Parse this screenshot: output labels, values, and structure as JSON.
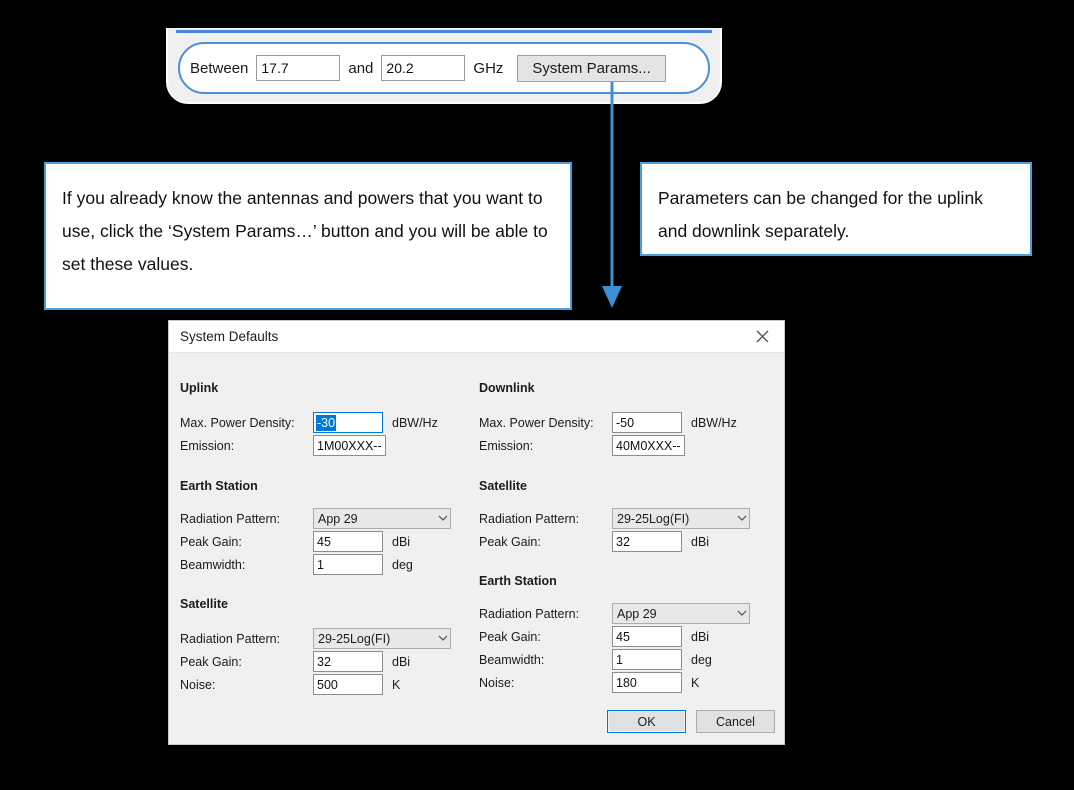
{
  "toolbar": {
    "between_label": "Between",
    "freq_low": "17.7",
    "and_label": "and",
    "freq_high": "20.2",
    "unit_label": "GHz",
    "system_params_button": "System Params..."
  },
  "annotations": {
    "left": "If you already know the antennas and powers that you want to use, click the ‘System Params…’ button and you will be able to set these values.",
    "right": "Parameters can be changed for the uplink and downlink separately."
  },
  "dialog": {
    "title": "System Defaults",
    "close_icon": "close-icon",
    "uplink": {
      "heading": "Uplink",
      "rows": [
        {
          "label": "Max. Power Density:",
          "value": "-30",
          "unit": "dBW/Hz",
          "type": "text",
          "focused": true,
          "selected": true
        },
        {
          "label": "Emission:",
          "value": "1M00XXX--",
          "unit": "",
          "type": "text-wide"
        }
      ],
      "earth_station": {
        "heading": "Earth Station",
        "rows": [
          {
            "label": "Radiation Pattern:",
            "value": "App 29",
            "unit": "",
            "type": "combo"
          },
          {
            "label": "Peak Gain:",
            "value": "45",
            "unit": "dBi",
            "type": "text"
          },
          {
            "label": "Beamwidth:",
            "value": "1",
            "unit": "deg",
            "type": "text"
          }
        ]
      },
      "satellite": {
        "heading": "Satellite",
        "rows": [
          {
            "label": "Radiation Pattern:",
            "value": "29-25Log(FI)",
            "unit": "",
            "type": "combo"
          },
          {
            "label": "Peak Gain:",
            "value": "32",
            "unit": "dBi",
            "type": "text"
          },
          {
            "label": "Noise:",
            "value": "500",
            "unit": "K",
            "type": "text"
          }
        ]
      }
    },
    "downlink": {
      "heading": "Downlink",
      "rows": [
        {
          "label": "Max. Power Density:",
          "value": "-50",
          "unit": "dBW/Hz",
          "type": "text"
        },
        {
          "label": "Emission:",
          "value": "40M0XXX--",
          "unit": "",
          "type": "text-wide"
        }
      ],
      "satellite": {
        "heading": "Satellite",
        "rows": [
          {
            "label": "Radiation Pattern:",
            "value": "29-25Log(FI)",
            "unit": "",
            "type": "combo"
          },
          {
            "label": "Peak Gain:",
            "value": "32",
            "unit": "dBi",
            "type": "text"
          }
        ]
      },
      "earth_station": {
        "heading": "Earth Station",
        "rows": [
          {
            "label": "Radiation Pattern:",
            "value": "App 29",
            "unit": "",
            "type": "combo"
          },
          {
            "label": "Peak Gain:",
            "value": "45",
            "unit": "dBi",
            "type": "text"
          },
          {
            "label": "Beamwidth:",
            "value": "1",
            "unit": "deg",
            "type": "text"
          },
          {
            "label": "Noise:",
            "value": "180",
            "unit": "K",
            "type": "text"
          }
        ]
      }
    },
    "ok_button": "OK",
    "cancel_button": "Cancel"
  },
  "colors": {
    "accent_blue": "#4a9fe0",
    "arrow_blue": "#3d8fd6",
    "selection_blue": "#0078d7",
    "dialog_bg": "#f0f0f0",
    "page_bg": "#000000"
  }
}
